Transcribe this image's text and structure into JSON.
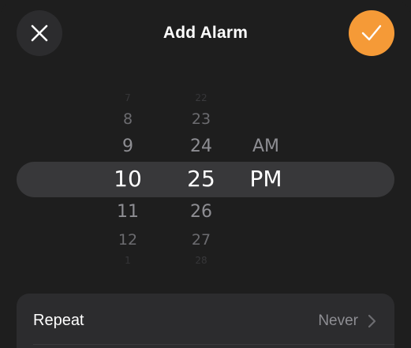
{
  "header": {
    "title": "Add Alarm"
  },
  "picker": {
    "hours": {
      "above": [
        "7",
        "8",
        "9"
      ],
      "selected": "10",
      "below": [
        "11",
        "12",
        "1"
      ]
    },
    "minutes": {
      "above": [
        "22",
        "23",
        "24"
      ],
      "selected": "25",
      "below": [
        "26",
        "27",
        "28"
      ]
    },
    "period": {
      "above": "AM",
      "selected": "PM"
    }
  },
  "settings": {
    "repeat_label": "Repeat",
    "repeat_value": "Never"
  },
  "colors": {
    "accent": "#f59a37",
    "background": "#1e1e1e",
    "button_bg": "#2c2c2e",
    "highlight": "#38383a"
  },
  "icons": {
    "close": "close-icon",
    "confirm": "checkmark-icon",
    "chevron": "chevron-right-icon"
  }
}
